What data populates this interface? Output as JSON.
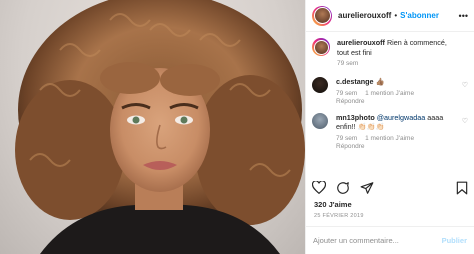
{
  "header": {
    "username": "aurelierouxoff",
    "separator": "•",
    "follow_label": "S'abonner",
    "more_icon": "more-horizontal-icon"
  },
  "caption": {
    "username": "aurelierouxoff",
    "text": "Rien à commencé, tout est fini",
    "time": "79 sem"
  },
  "comments": [
    {
      "username": "c.destange",
      "text": "👍🏽",
      "time": "79 sem",
      "likes": "1 mention J'aime",
      "reply": "Répondre"
    },
    {
      "username": "mn13photo",
      "mention": "@aurelgwadaa",
      "text": "aaaa enfin!! 👏🏻👏🏻👏🏻",
      "time": "79 sem",
      "likes": "1 mention J'aime",
      "reply": "Répondre"
    }
  ],
  "actions": {
    "icons": [
      "heart-icon",
      "comment-icon",
      "share-icon",
      "bookmark-icon"
    ]
  },
  "likes_text": "320 J'aime",
  "date_text": "25 FÉVRIER 2019",
  "add_comment": {
    "placeholder": "Ajouter un commentaire...",
    "publish_label": "Publier"
  },
  "colors": {
    "accent": "#0095f6",
    "publish_disabled": "#b2dffc",
    "muted": "#8e8e8e"
  }
}
